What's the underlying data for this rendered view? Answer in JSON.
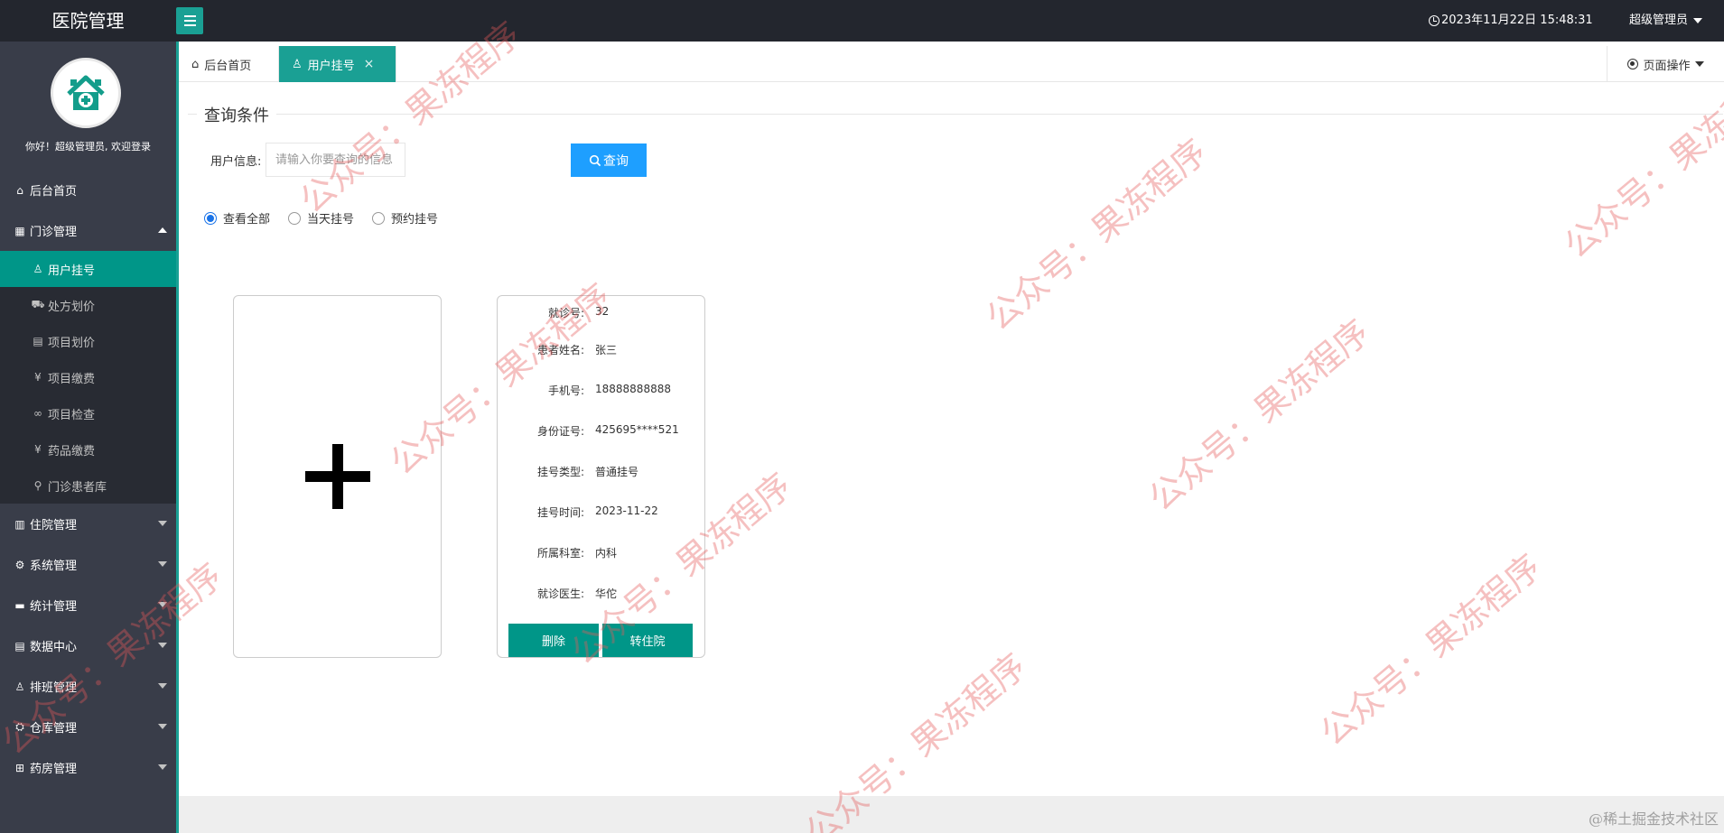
{
  "app": {
    "title": "医院管理"
  },
  "header": {
    "datetime": "2023年11月22日 15:48:31",
    "user": "超级管理员"
  },
  "sidebar": {
    "welcome": "你好！超级管理员, 欢迎登录",
    "items": [
      {
        "label": "后台首页",
        "icon": "home-icon"
      },
      {
        "label": "门诊管理",
        "icon": "grid-icon"
      },
      {
        "label": "住院管理",
        "icon": "bed-icon"
      },
      {
        "label": "系统管理",
        "icon": "gear-icon"
      },
      {
        "label": "统计管理",
        "icon": "monitor-icon"
      },
      {
        "label": "数据中心",
        "icon": "document-icon"
      },
      {
        "label": "排班管理",
        "icon": "user-icon"
      },
      {
        "label": "仓库管理",
        "icon": "warehouse-icon"
      },
      {
        "label": "药房管理",
        "icon": "book-icon"
      }
    ],
    "sub_items": [
      {
        "label": "用户挂号",
        "icon": "user-icon"
      },
      {
        "label": "处方划价",
        "icon": "cart-icon"
      },
      {
        "label": "项目划价",
        "icon": "file-icon"
      },
      {
        "label": "项目缴费",
        "icon": "yen-icon"
      },
      {
        "label": "项目检查",
        "icon": "infinity-icon"
      },
      {
        "label": "药品缴费",
        "icon": "yen-icon"
      },
      {
        "label": "门诊患者库",
        "icon": "person-icon"
      }
    ]
  },
  "tabs": {
    "home": "后台首页",
    "active": "用户挂号",
    "page_ops": "页面操作"
  },
  "query": {
    "legend": "查询条件",
    "label": "用户信息:",
    "placeholder": "请输入你要查询的信息",
    "button": "查询"
  },
  "filters": [
    "查看全部",
    "当天挂号",
    "预约挂号"
  ],
  "selected_filter": "查看全部",
  "record": {
    "fields": [
      {
        "key": "就诊号:",
        "value": "32"
      },
      {
        "key": "患者姓名:",
        "value": "张三"
      },
      {
        "key": "手机号:",
        "value": "18888888888"
      },
      {
        "key": "身份证号:",
        "value": "425695****521"
      },
      {
        "key": "挂号类型:",
        "value": "普通挂号"
      },
      {
        "key": "挂号时间:",
        "value": "2023-11-22"
      },
      {
        "key": "所属科室:",
        "value": "内科"
      },
      {
        "key": "就诊医生:",
        "value": "华佗"
      }
    ],
    "delete_label": "删除",
    "transfer_label": "转住院"
  },
  "watermark": "公众号：果冻程序",
  "credit": "@稀土掘金技术社区"
}
